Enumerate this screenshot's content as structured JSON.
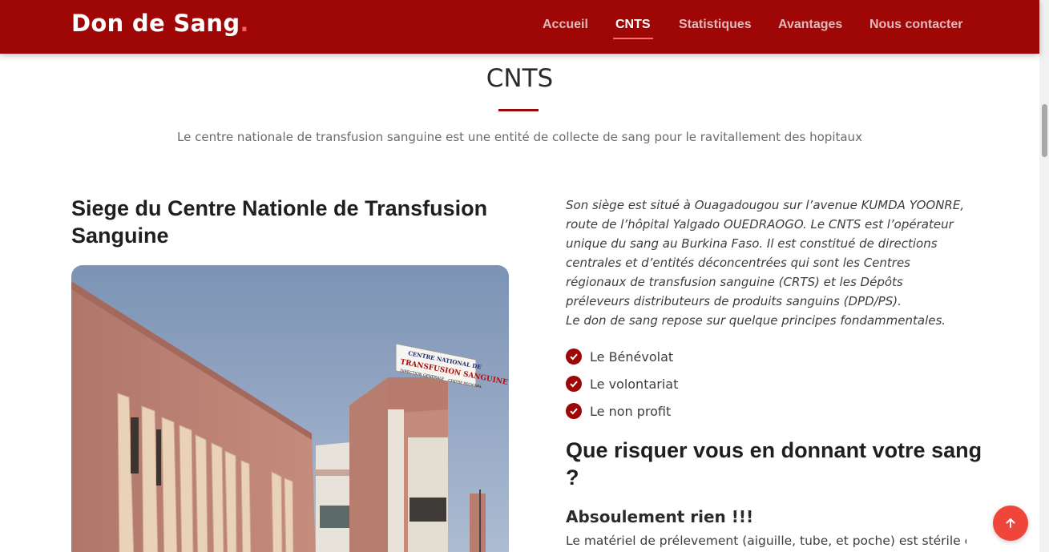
{
  "brand": {
    "name": "Don de Sang",
    "dot": ".",
    "accent": "#9f0606"
  },
  "nav": {
    "items": [
      {
        "label": "Accueil",
        "active": false
      },
      {
        "label": "CNTS",
        "active": true
      },
      {
        "label": "Statistiques",
        "active": false
      },
      {
        "label": "Avantages",
        "active": false
      },
      {
        "label": "Nous contacter",
        "active": false
      }
    ]
  },
  "section": {
    "title": "CNTS",
    "subtitle": "Le centre nationale de transfusion sanguine est une entité de collecte de sang pour le ravitallement des hopitaux"
  },
  "left": {
    "heading": "Siege du Centre Nationle de Transfusion Sanguine",
    "sign": {
      "line1": "CENTRE NATIONAL DE",
      "line2": "TRANSFUSION SANGUINE",
      "line3": "DIRECTION GENERALE",
      "line4": "CENTRE REGIONAL"
    }
  },
  "right": {
    "paragraph": "Son siège est situé à Ouagadougou sur l’avenue KUMDA YOONRE, route de l’hôpital Yalgado OUEDRAOGO. Le CNTS est l’opérateur unique du sang au Burkina Faso. Il est constitué de directions centrales et d’entités déconcentrées qui sont les Centres régionaux de transfusion sanguine (CRTS) et les Dépôts préleveurs distributeurs de produits sanguins (DPD/PS).",
    "paragraph2": "Le don de sang repose sur quelque principes fondammentales.",
    "checklist": [
      "Le Bénévolat",
      "Le volontariat",
      "Le non profit"
    ],
    "heading": "Que risquer vous en donnant votre sang ?",
    "subheading": "Absoulement rien !!!",
    "para": "Le matériel de prélevement (aiguille, tube, et poche) est stérile et à"
  },
  "icons": {
    "check": "check-circle-icon",
    "back_to_top": "arrow-up-icon"
  }
}
